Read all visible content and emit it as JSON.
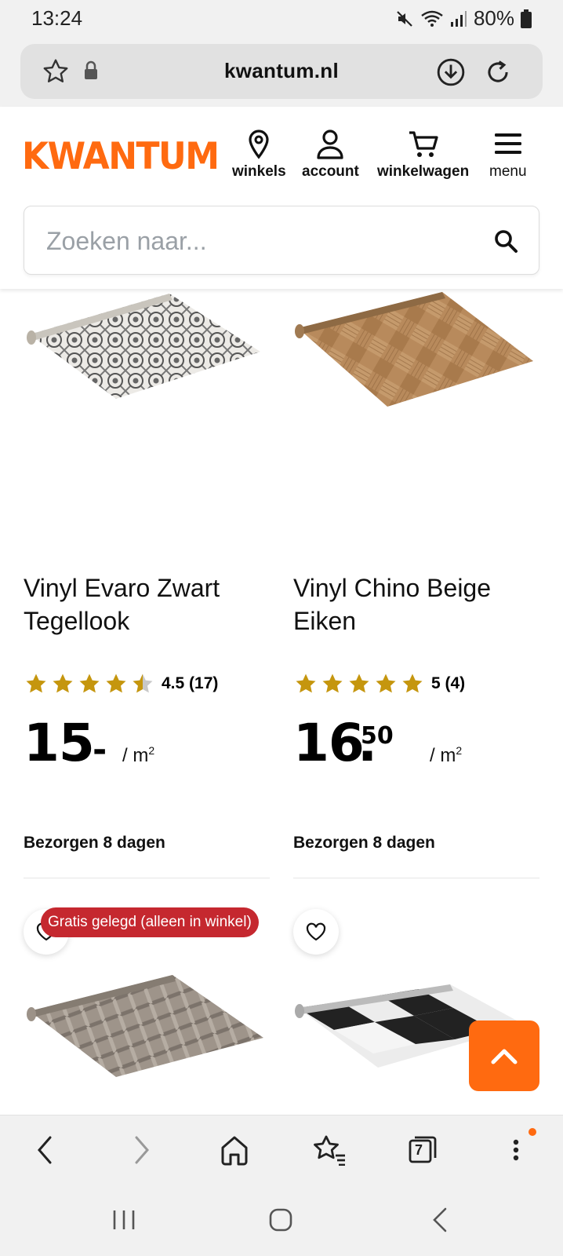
{
  "status_bar": {
    "time": "13:24",
    "battery": "80%"
  },
  "browser": {
    "url": "kwantum.nl"
  },
  "site": {
    "logo": "KWANTUM",
    "brand_color": "#ff6a10",
    "nav": [
      {
        "label": "winkels",
        "icon": "location-pin-icon"
      },
      {
        "label": "account",
        "icon": "user-icon"
      },
      {
        "label": "winkelwagen",
        "icon": "cart-icon"
      },
      {
        "label": "menu",
        "icon": "hamburger-icon"
      }
    ],
    "search": {
      "placeholder": "Zoeken naar..."
    }
  },
  "products": [
    {
      "title": "Vinyl Evaro Zwart Tegellook",
      "rating": 4.5,
      "rating_text": "4.5 (17)",
      "price_main": "15",
      "price_cents": "-",
      "price_unit": "/ m",
      "price_unit_sup": "2",
      "delivery": "Bezorgen 8 dagen"
    },
    {
      "title": "Vinyl Chino Beige Eiken",
      "rating": 5,
      "rating_text": "5 (4)",
      "price_main": "16",
      "price_cents": "50",
      "price_unit": "/ m",
      "price_unit_sup": "2",
      "delivery": "Bezorgen 8 dagen"
    },
    {
      "badge": "Gratis gelegd (alleen in winkel)",
      "badge_color": "#c5282f"
    },
    {}
  ],
  "browser_nav": [
    "back-icon",
    "forward-icon",
    "home-icon",
    "bookmarks-icon",
    "tabs-icon",
    "more-icon"
  ],
  "tabs_count": "7"
}
